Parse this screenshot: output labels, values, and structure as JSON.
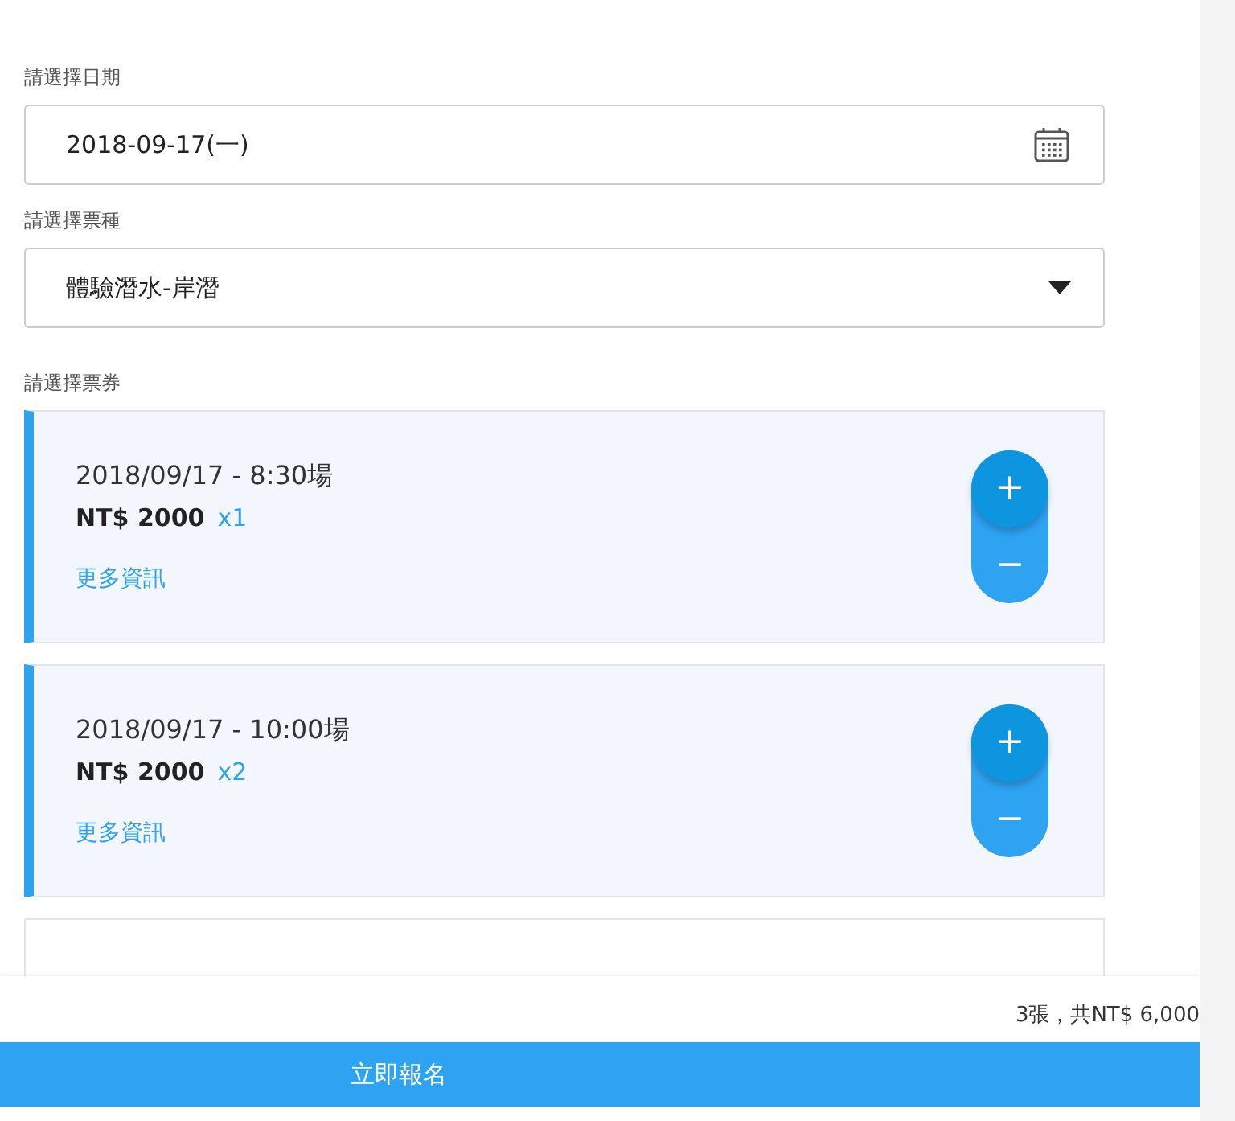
{
  "date_field": {
    "label": "請選擇日期",
    "value": "2018-09-17(一)"
  },
  "ticket_type": {
    "label": "請選擇票種",
    "value": "體驗潛水-岸潛"
  },
  "tickets_label": "請選擇票券",
  "tickets": [
    {
      "session": "2018/09/17 - 8:30場",
      "price": "NT$ 2000",
      "quantity": "x1",
      "link": "更多資訊",
      "increment": "+",
      "decrement": "−"
    },
    {
      "session": "2018/09/17 - 10:00場",
      "price": "NT$ 2000",
      "quantity": "x2",
      "link": "更多資訊",
      "increment": "+",
      "decrement": "−"
    }
  ],
  "summary": "3張，共NT$ 6,000",
  "submit_button": "立即報名"
}
